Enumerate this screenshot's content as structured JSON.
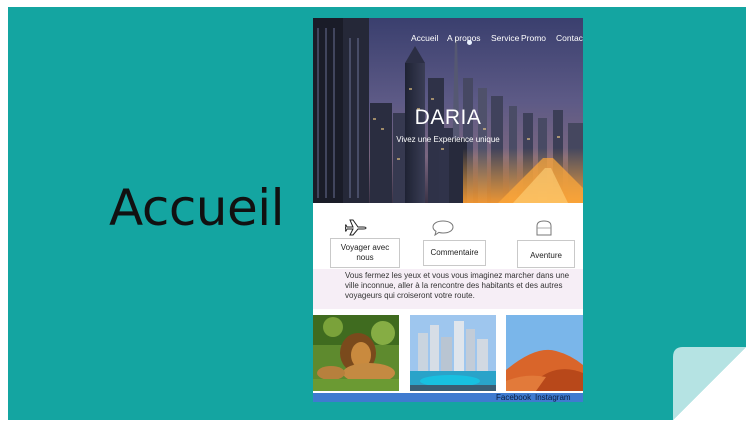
{
  "slide": {
    "title": "Accueil"
  },
  "mockup": {
    "nav": [
      {
        "id": "accueil",
        "label": "Accueil"
      },
      {
        "id": "apropos",
        "label": "A propos"
      },
      {
        "id": "service",
        "label": "Service"
      },
      {
        "id": "promo",
        "label": "Promo"
      },
      {
        "id": "contact",
        "label": "Contac"
      }
    ],
    "hero": {
      "title": "DARIA",
      "subtitle": "Vivez une Experience unique"
    },
    "features": [
      {
        "icon": "airplane-icon",
        "label": "Voyager avec nous"
      },
      {
        "icon": "comment-bubble-icon",
        "label": "Commentaire"
      },
      {
        "icon": "adventure-icon",
        "label": "Aventure"
      }
    ],
    "description": "Vous fermez les yeux et vous vous imaginez marcher dans une ville inconnue, aller à la rencontre des habitants et des autres voyageurs qui croiseront votre route.",
    "gallery": [
      {
        "name": "lion-photo"
      },
      {
        "name": "marina-photo"
      },
      {
        "name": "desert-photo"
      }
    ],
    "footer": {
      "links": [
        "Facebook",
        "Instagram"
      ]
    }
  },
  "colors": {
    "slide_bg": "#14a5a1",
    "footer_bar": "#3f7bd0",
    "desc_bg": "#f6eef6"
  }
}
